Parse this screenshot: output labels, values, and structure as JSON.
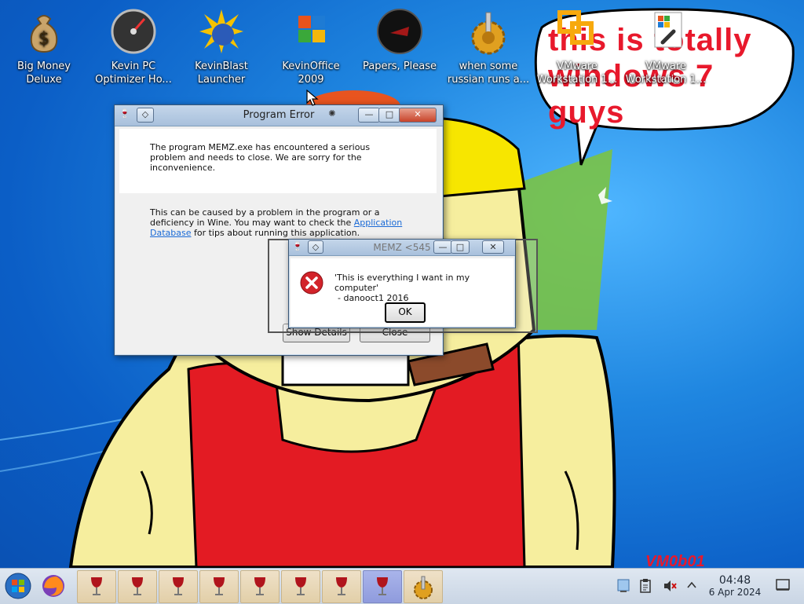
{
  "desktop": {
    "icons": [
      {
        "label": "Big Money Deluxe",
        "icon": "money-bag-icon"
      },
      {
        "label": "Kevin PC Optimizer Ho...",
        "icon": "speedometer-icon"
      },
      {
        "label": "KevinBlast Launcher",
        "icon": "sunburst-disc-icon"
      },
      {
        "label": "KevinOffice 2009",
        "icon": "office-logo-icon"
      },
      {
        "label": "Papers, Please",
        "icon": "papers-please-seal-icon"
      },
      {
        "label": "when some russian runs a...",
        "icon": "gear-joystick-icon"
      },
      {
        "label": "VMware Workstation 1...",
        "icon": "vmware-icon"
      },
      {
        "label": "VMware Workstation 1...",
        "icon": "shortcut-link-icon"
      }
    ],
    "bubble_text": "this is totally windows 7 guys",
    "watermark": "VM0b01"
  },
  "program_error": {
    "title": "Program Error",
    "message": "The program MEMZ.exe has encountered a serious problem and needs to close. We are sorry for the inconvenience.",
    "detail_pre": "This can be caused by a problem in the program or a deficiency in Wine. You may want to check the",
    "detail_link": "Application Database",
    "detail_post": "for tips about running this application.",
    "show_details_label": "Show Details",
    "close_label": "Close"
  },
  "memz_dialog": {
    "title": "MEMZ <545",
    "message_line1": "'This is everything I want in my computer'",
    "message_line2": "- danooct1 2016",
    "ok_label": "OK"
  },
  "taskbar": {
    "time": "04:48",
    "date": "6 Apr 2024"
  },
  "colors": {
    "bubble_text": "#e8192c",
    "desktop_blue": "#1f86e0",
    "taskbar": "#d3dde9"
  }
}
